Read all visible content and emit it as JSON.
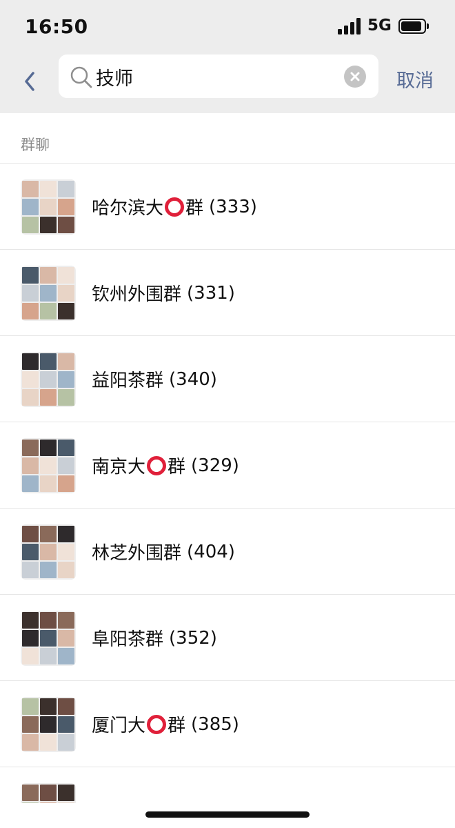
{
  "status_bar": {
    "time": "16:50",
    "network": "5G",
    "signal_bars": 4,
    "battery_level": 0.9
  },
  "search": {
    "query": "技师",
    "cancel_label": "取消"
  },
  "section": {
    "title": "群聊"
  },
  "groups": [
    {
      "prefix": "哈尔滨大",
      "ring": true,
      "suffix": "群",
      "count": "(333)"
    },
    {
      "prefix": "钦州外围群",
      "ring": false,
      "suffix": "",
      "count": "(331)"
    },
    {
      "prefix": "益阳茶群",
      "ring": false,
      "suffix": "",
      "count": "(340)"
    },
    {
      "prefix": "南京大",
      "ring": true,
      "suffix": "群",
      "count": "(329)"
    },
    {
      "prefix": "林芝外围群",
      "ring": false,
      "suffix": "",
      "count": "(404)"
    },
    {
      "prefix": "阜阳茶群",
      "ring": false,
      "suffix": "",
      "count": "(352)"
    },
    {
      "prefix": "厦门大",
      "ring": true,
      "suffix": "群",
      "count": "(385)"
    }
  ],
  "colors": {
    "header_bg": "#ededed",
    "accent": "#576b95",
    "ring": "#e0203a",
    "avatar_tiles": [
      "#d9b8a6",
      "#3b302c",
      "#c9cfd6",
      "#8a6a5a",
      "#e8d4c6",
      "#4a5a6a",
      "#b6c2a4",
      "#f0e2d8",
      "#6e4e44",
      "#9fb5c9",
      "#2e2a2c",
      "#d6a48c"
    ]
  }
}
